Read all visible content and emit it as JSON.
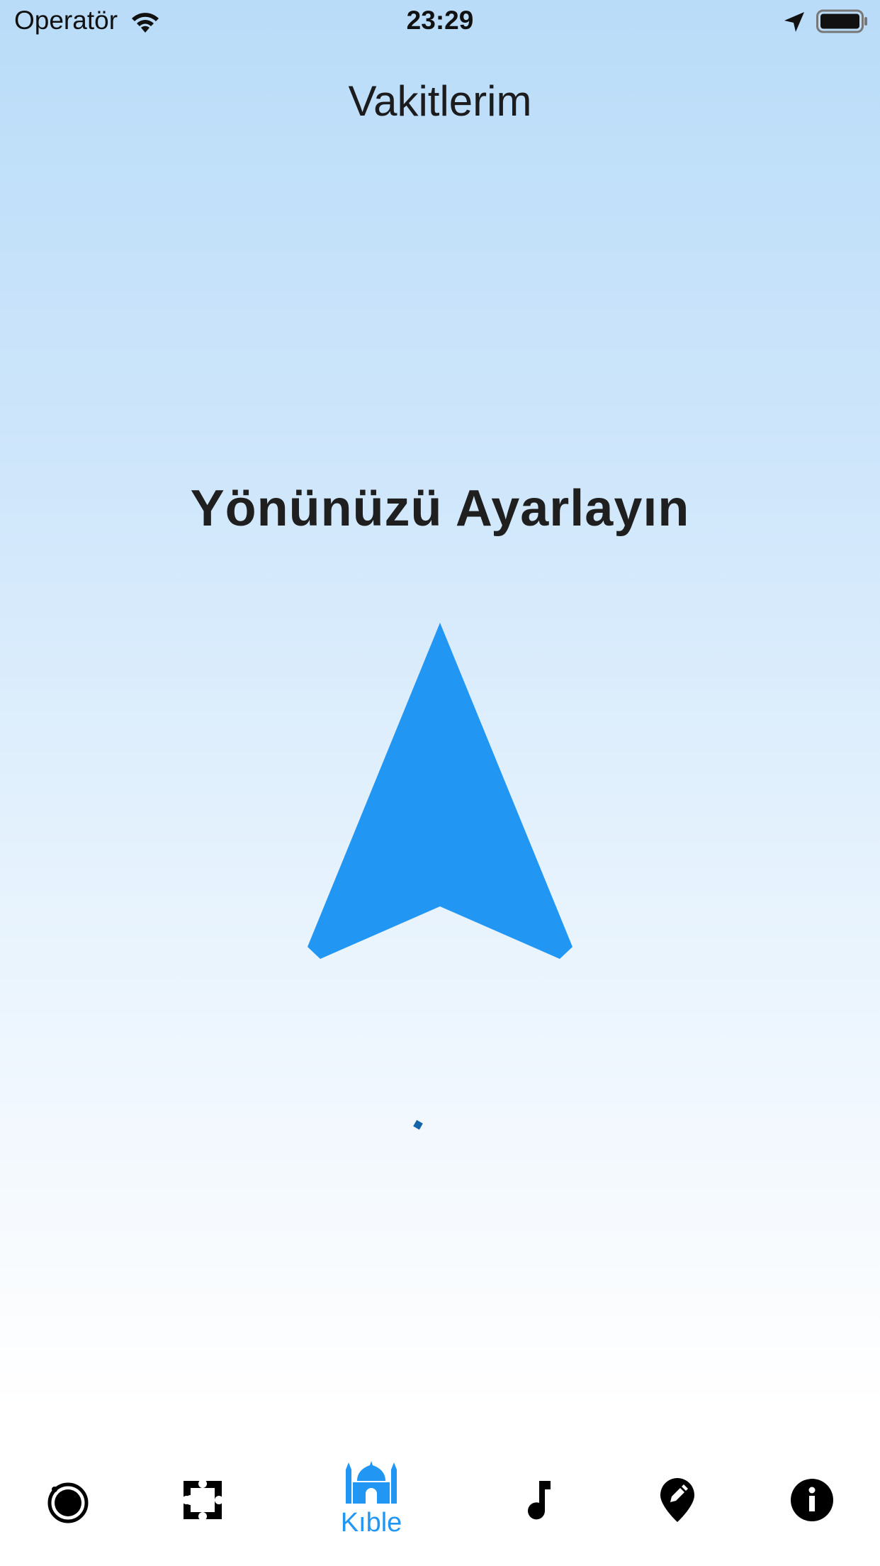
{
  "status_bar": {
    "carrier": "Operatör",
    "time": "23:29"
  },
  "nav": {
    "title": "Vakitlerim"
  },
  "qibla": {
    "heading": "Yönünüzü Ayarlayın",
    "arrow_color": "#2196f3"
  },
  "tab_bar": {
    "active_color": "#2196f3",
    "inactive_color": "#000000",
    "tabs": [
      {
        "icon": "prayer-times-icon",
        "label": ""
      },
      {
        "icon": "puzzle-icon",
        "label": ""
      },
      {
        "icon": "mosque-icon",
        "label": "Kıble"
      },
      {
        "icon": "music-note-icon",
        "label": ""
      },
      {
        "icon": "edit-location-icon",
        "label": ""
      },
      {
        "icon": "info-icon",
        "label": ""
      }
    ]
  }
}
